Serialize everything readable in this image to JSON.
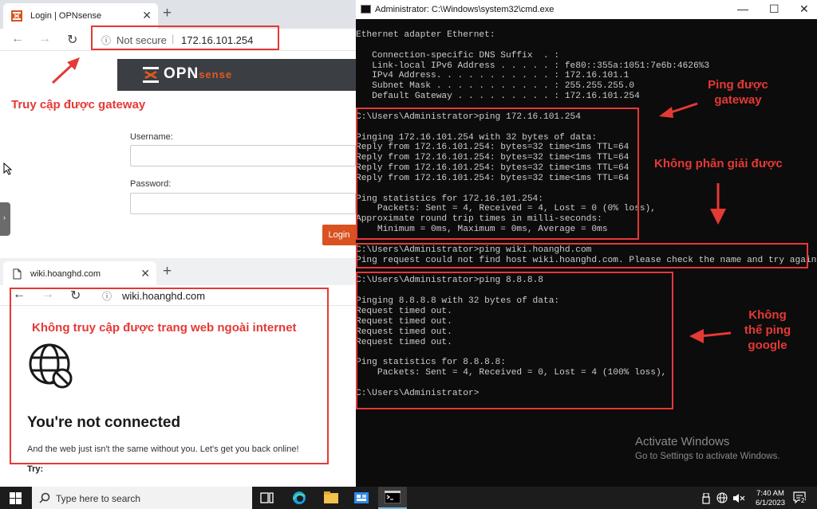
{
  "browser1": {
    "tab_title": "Login | OPNsense",
    "tab_close": "✕",
    "new_tab": "+",
    "security": "Not secure",
    "url": "172.16.101.254",
    "logo_opn": "OPN",
    "logo_sense": "sense",
    "username_label": "Username:",
    "password_label": "Password:",
    "login_button": "Login"
  },
  "browser2": {
    "tab_title": "wiki.hoanghd.com",
    "tab_close": "✕",
    "new_tab": "+",
    "url": "wiki.hoanghd.com",
    "heading": "You're not connected",
    "message": "And the web just isn't the same without you. Let's get you back online!",
    "try_label": "Try:"
  },
  "annotations": {
    "gateway_access": "Truy cập được gateway",
    "no_internet": "Không truy cập được trang web ngoài internet",
    "ping_gateway": [
      "Ping được",
      "gateway"
    ],
    "dns_fail": "Không phân giải được",
    "ping_google": [
      "Không",
      "thể ping",
      "google"
    ],
    "accent_color": "#e53935"
  },
  "cmd": {
    "title": "Administrator: C:\\Windows\\system32\\cmd.exe",
    "lines": [
      "Ethernet adapter Ethernet:",
      "",
      "   Connection-specific DNS Suffix  . :",
      "   Link-local IPv6 Address . . . . . : fe80::355a:1051:7e6b:4626%3",
      "   IPv4 Address. . . . . . . . . . . : 172.16.101.1",
      "   Subnet Mask . . . . . . . . . . . : 255.255.255.0",
      "   Default Gateway . . . . . . . . . : 172.16.101.254",
      "",
      "C:\\Users\\Administrator>ping 172.16.101.254",
      "",
      "Pinging 172.16.101.254 with 32 bytes of data:",
      "Reply from 172.16.101.254: bytes=32 time<1ms TTL=64",
      "Reply from 172.16.101.254: bytes=32 time<1ms TTL=64",
      "Reply from 172.16.101.254: bytes=32 time<1ms TTL=64",
      "Reply from 172.16.101.254: bytes=32 time<1ms TTL=64",
      "",
      "Ping statistics for 172.16.101.254:",
      "    Packets: Sent = 4, Received = 4, Lost = 0 (0% loss),",
      "Approximate round trip times in milli-seconds:",
      "    Minimum = 0ms, Maximum = 0ms, Average = 0ms",
      "",
      "C:\\Users\\Administrator>ping wiki.hoanghd.com",
      "Ping request could not find host wiki.hoanghd.com. Please check the name and try again.",
      "",
      "C:\\Users\\Administrator>ping 8.8.8.8",
      "",
      "Pinging 8.8.8.8 with 32 bytes of data:",
      "Request timed out.",
      "Request timed out.",
      "Request timed out.",
      "Request timed out.",
      "",
      "Ping statistics for 8.8.8.8:",
      "    Packets: Sent = 4, Received = 0, Lost = 4 (100% loss),",
      "",
      "C:\\Users\\Administrator>"
    ]
  },
  "watermark": {
    "title": "Activate Windows",
    "subtitle": "Go to Settings to activate Windows."
  },
  "taskbar": {
    "search_placeholder": "Type here to search",
    "time": "7:40 AM",
    "date": "6/1/2023",
    "notification_count": "2"
  }
}
